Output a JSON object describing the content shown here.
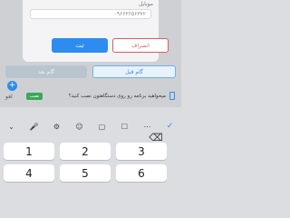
{
  "dialog": {
    "field_label": "موبایل",
    "phone_value": "۰۹۶۶۳۶۵۶۳۷۲",
    "cancel_label": "انصراف",
    "confirm_label": "ثبت"
  },
  "steps": {
    "prev_label": "گام قبل",
    "next_label": "گام بعد"
  },
  "install_prompt": {
    "text": "میخواهید برنامه رو روی دستگاهتون نصب کنید؟",
    "install_label": "نصب",
    "cancel_label": "لغو"
  },
  "fab": {
    "symbol": "+"
  },
  "keyboard_toolbar": {
    "items": [
      "⌄",
      "🎤",
      "⚙",
      "☺",
      "▢",
      "☐",
      "⋯",
      "✓"
    ]
  },
  "keypad": {
    "keys": [
      "1",
      "2",
      "3",
      "4",
      "5",
      "6"
    ],
    "backspace_label": "⌫"
  },
  "colors": {
    "accent": "#2d8cf0",
    "danger": "#e05a5a",
    "success": "#3aa757"
  }
}
